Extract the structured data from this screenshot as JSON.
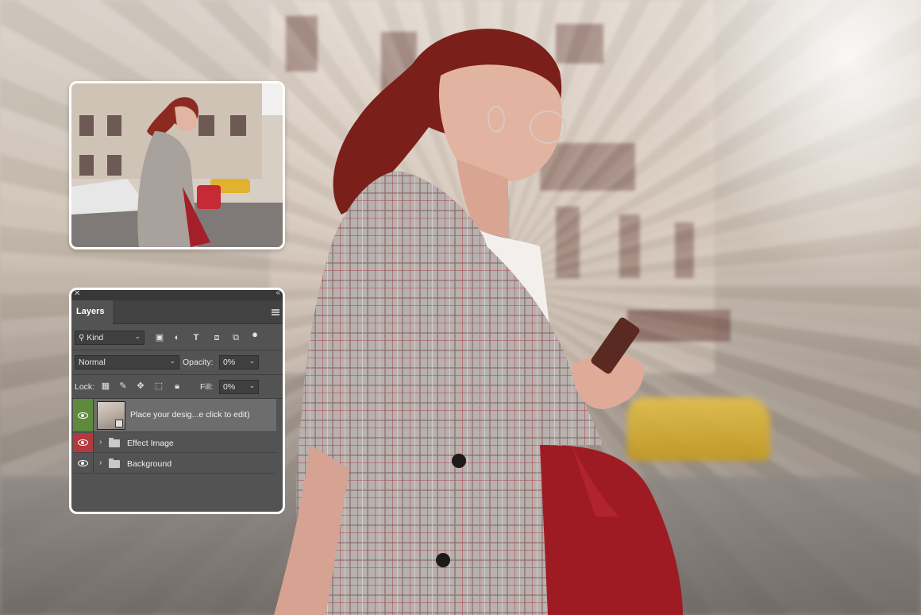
{
  "colors": {
    "panel_bg": "#535353",
    "eye_active": "#5e8a3e",
    "eye_effect": "#b3393e"
  },
  "layers_panel": {
    "tab_label": "Layers",
    "filter_kind": "Kind",
    "blend_mode": "Normal",
    "opacity_label": "Opacity:",
    "opacity_value": "0%",
    "lock_label": "Lock:",
    "fill_label": "Fill:",
    "fill_value": "0%",
    "layers": [
      {
        "name": "Place your desig...e click to edit)",
        "visible": true,
        "selected": true
      },
      {
        "name": "Effect Image",
        "visible": true,
        "type": "group"
      },
      {
        "name": "Background",
        "visible": true,
        "type": "group"
      }
    ]
  },
  "icons": [
    "close-icon",
    "collapse-icon",
    "panel-menu-icon",
    "search-icon",
    "image-filter-icon",
    "adjustment-filter-icon",
    "type-filter-icon",
    "shape-filter-icon",
    "smart-object-filter-icon",
    "toggle-filter-icon",
    "lock-transparent-icon",
    "lock-image-icon",
    "lock-position-icon",
    "lock-artboard-icon",
    "lock-all-icon",
    "eye-icon",
    "folder-icon"
  ]
}
